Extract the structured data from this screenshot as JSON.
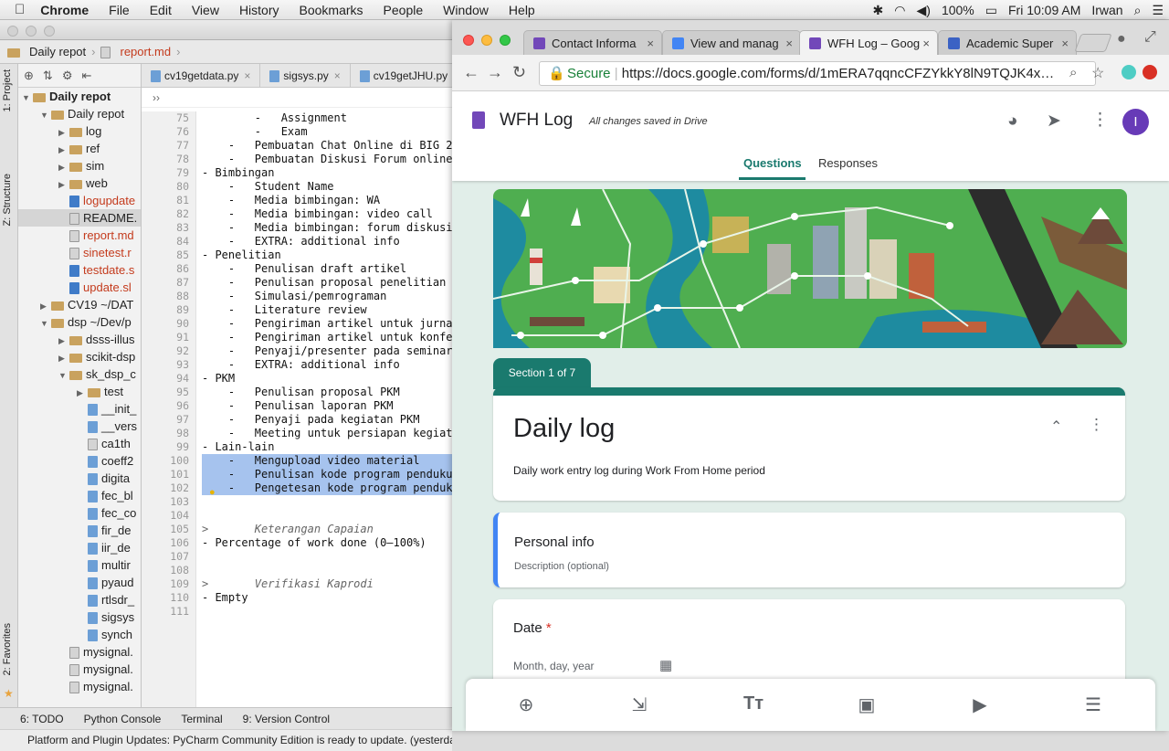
{
  "menubar": {
    "app": "Chrome",
    "items": [
      "File",
      "Edit",
      "View",
      "History",
      "Bookmarks",
      "People",
      "Window",
      "Help"
    ],
    "battery": "100%",
    "clock": "Fri 10:09 AM",
    "user": "Irwan"
  },
  "ide": {
    "breadcrumb_root": "Daily repot",
    "breadcrumb_file": "report.md",
    "side_tabs": {
      "project": "1: Project",
      "structure": "Z: Structure",
      "favorites": "2: Favorites"
    },
    "editor_tabs": [
      "cv19getdata.py",
      "sigsys.py",
      "cv19getJHU.py"
    ],
    "tree": [
      {
        "label": "Daily repot",
        "depth": 0,
        "arrow": "▼",
        "kind": "folder",
        "bold": true
      },
      {
        "label": "Daily repot",
        "depth": 1,
        "arrow": "▼",
        "kind": "folder"
      },
      {
        "label": "log",
        "depth": 2,
        "arrow": "▶",
        "kind": "folder"
      },
      {
        "label": "ref",
        "depth": 2,
        "arrow": "▶",
        "kind": "folder"
      },
      {
        "label": "sim",
        "depth": 2,
        "arrow": "▶",
        "kind": "folder"
      },
      {
        "label": "web",
        "depth": 2,
        "arrow": "▶",
        "kind": "folder"
      },
      {
        "label": "logupdate",
        "depth": 2,
        "arrow": "",
        "kind": "sh",
        "color": "red"
      },
      {
        "label": "README.",
        "depth": 2,
        "arrow": "",
        "kind": "md",
        "sel": true
      },
      {
        "label": "report.md",
        "depth": 2,
        "arrow": "",
        "kind": "md",
        "color": "red"
      },
      {
        "label": "sinetest.r",
        "depth": 2,
        "arrow": "",
        "kind": "md",
        "color": "red"
      },
      {
        "label": "testdate.s",
        "depth": 2,
        "arrow": "",
        "kind": "sh",
        "color": "red"
      },
      {
        "label": "update.sl",
        "depth": 2,
        "arrow": "",
        "kind": "sh",
        "color": "red"
      },
      {
        "label": "CV19 ~/DAT",
        "depth": 1,
        "arrow": "▶",
        "kind": "folder"
      },
      {
        "label": "dsp ~/Dev/p",
        "depth": 1,
        "arrow": "▼",
        "kind": "folder"
      },
      {
        "label": "dsss-illus",
        "depth": 2,
        "arrow": "▶",
        "kind": "folder"
      },
      {
        "label": "scikit-dsp",
        "depth": 2,
        "arrow": "▶",
        "kind": "folder"
      },
      {
        "label": "sk_dsp_c",
        "depth": 2,
        "arrow": "▼",
        "kind": "folder"
      },
      {
        "label": "test",
        "depth": 3,
        "arrow": "▶",
        "kind": "folder"
      },
      {
        "label": "__init_",
        "depth": 3,
        "arrow": "",
        "kind": "py"
      },
      {
        "label": "__vers",
        "depth": 3,
        "arrow": "",
        "kind": "py"
      },
      {
        "label": "ca1th",
        "depth": 3,
        "arrow": "",
        "kind": "md"
      },
      {
        "label": "coeff2",
        "depth": 3,
        "arrow": "",
        "kind": "py"
      },
      {
        "label": "digita",
        "depth": 3,
        "arrow": "",
        "kind": "py"
      },
      {
        "label": "fec_bl",
        "depth": 3,
        "arrow": "",
        "kind": "py"
      },
      {
        "label": "fec_co",
        "depth": 3,
        "arrow": "",
        "kind": "py"
      },
      {
        "label": "fir_de",
        "depth": 3,
        "arrow": "",
        "kind": "py"
      },
      {
        "label": "iir_de",
        "depth": 3,
        "arrow": "",
        "kind": "py"
      },
      {
        "label": "multir",
        "depth": 3,
        "arrow": "",
        "kind": "py"
      },
      {
        "label": "pyaud",
        "depth": 3,
        "arrow": "",
        "kind": "py"
      },
      {
        "label": "rtlsdr_",
        "depth": 3,
        "arrow": "",
        "kind": "py"
      },
      {
        "label": "sigsys",
        "depth": 3,
        "arrow": "",
        "kind": "py"
      },
      {
        "label": "synch",
        "depth": 3,
        "arrow": "",
        "kind": "py"
      },
      {
        "label": "mysignal.",
        "depth": 2,
        "arrow": "",
        "kind": "md"
      },
      {
        "label": "mysignal.",
        "depth": 2,
        "arrow": "",
        "kind": "md"
      },
      {
        "label": "mysignal.",
        "depth": 2,
        "arrow": "",
        "kind": "md"
      }
    ],
    "lines": [
      {
        "n": "75",
        "t": "        -   Assignment"
      },
      {
        "n": "76",
        "t": "        -   Exam"
      },
      {
        "n": "77",
        "t": "    -   Pembuatan Chat Online di BIG 2."
      },
      {
        "n": "78",
        "t": "    -   Pembuatan Diskusi Forum online"
      },
      {
        "n": "79",
        "t": "- Bimbingan"
      },
      {
        "n": "80",
        "t": "    -   Student Name"
      },
      {
        "n": "81",
        "t": "    -   Media bimbingan: WA"
      },
      {
        "n": "82",
        "t": "    -   Media bimbingan: video call"
      },
      {
        "n": "83",
        "t": "    -   Media bimbingan: forum diskusi"
      },
      {
        "n": "84",
        "t": "    -   EXTRA: additional info"
      },
      {
        "n": "85",
        "t": "- Penelitian"
      },
      {
        "n": "86",
        "t": "    -   Penulisan draft artikel"
      },
      {
        "n": "87",
        "t": "    -   Penulisan proposal penelitian"
      },
      {
        "n": "88",
        "t": "    -   Simulasi/pemrograman"
      },
      {
        "n": "89",
        "t": "    -   Literature review"
      },
      {
        "n": "90",
        "t": "    -   Pengiriman artikel untuk jurnal"
      },
      {
        "n": "91",
        "t": "    -   Pengiriman artikel untuk konfer"
      },
      {
        "n": "92",
        "t": "    -   Penyaji/presenter pada seminar"
      },
      {
        "n": "93",
        "t": "    -   EXTRA: additional info"
      },
      {
        "n": "94",
        "t": "- PKM"
      },
      {
        "n": "95",
        "t": "    -   Penulisan proposal PKM"
      },
      {
        "n": "96",
        "t": "    -   Penulisan laporan PKM"
      },
      {
        "n": "97",
        "t": "    -   Penyaji pada kegiatan PKM"
      },
      {
        "n": "98",
        "t": "    -   Meeting untuk persiapan kegiata"
      },
      {
        "n": "99",
        "t": "- Lain-lain"
      },
      {
        "n": "100",
        "t": "    -   Mengupload video material",
        "hl": true
      },
      {
        "n": "101",
        "t": "    -   Penulisan kode program pendukung",
        "hl": true
      },
      {
        "n": "102",
        "t": "    -   Pengetesan kode program pendukun",
        "hl": true
      },
      {
        "n": "103",
        "t": ""
      },
      {
        "n": "104",
        "t": ""
      },
      {
        "n": "105",
        "t": ">       Keterangan Capaian",
        "it": true
      },
      {
        "n": "106",
        "t": "- Percentage of work done (0–100%)"
      },
      {
        "n": "107",
        "t": ""
      },
      {
        "n": "108",
        "t": ""
      },
      {
        "n": "109",
        "t": ">       Verifikasi Kaprodi",
        "it": true
      },
      {
        "n": "110",
        "t": "- Empty"
      },
      {
        "n": "111",
        "t": ""
      }
    ],
    "bottom_tools": [
      "6: TODO",
      "Python Console",
      "Terminal",
      "9: Version Control"
    ],
    "status": "Platform and Plugin Updates: PyCharm Community Edition is ready to update. (yesterda"
  },
  "chrome": {
    "tabs": [
      {
        "label": "Contact Informa",
        "color": "#7248b9"
      },
      {
        "label": "View and manag",
        "color": "#4285f4"
      },
      {
        "label": "WFH Log – Goog",
        "color": "#7248b9",
        "active": true
      },
      {
        "label": "Academic Super",
        "color": "#3b62c4"
      }
    ],
    "secure_label": "Secure",
    "url": "https://docs.google.com/forms/d/1mERA7qqncCFZYkkY8lN9TQJK4x…",
    "form": {
      "title": "WFH Log",
      "saved": "All changes saved in Drive",
      "avatar": "I",
      "tab_questions": "Questions",
      "tab_responses": "Responses",
      "section_badge": "Section 1 of 7",
      "section_title": "Daily log",
      "section_desc": "Daily work entry log during Work From Home period",
      "block_title": "Personal info",
      "block_desc": "Description (optional)",
      "q_title": "Date",
      "q_required": "*",
      "q_placeholder": "Month, day, year"
    },
    "colors": {
      "accent": "#1a7a6e",
      "purple": "#673ab7",
      "page_bg": "#e1eee9"
    }
  }
}
